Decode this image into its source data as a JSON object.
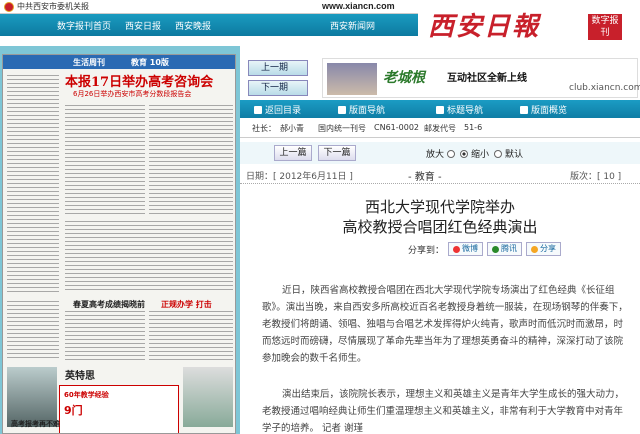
{
  "header": {
    "party_site": "中共西安市委机关报",
    "url": "www.xiancn.com",
    "nav": [
      "数字报刊首页",
      "西安日报",
      "西安晚报"
    ],
    "nav_right": "西安新闻网",
    "logo": "西安日報",
    "badge": "数字报刊"
  },
  "paper": {
    "section_1": "生活周刊",
    "section_2": "教育 10版",
    "headline": "本报17日举办高考咨询会",
    "subhead": "6月26日举办西安市高考分数段报告会",
    "box_1": "春夏高考成绩揭晓前",
    "box_2": "正规办学  打击",
    "brand": "英特思",
    "ad_title": "60年教学经验",
    "ad_big": "9门",
    "footer_box": "高考报考再不难"
  },
  "page_nav": {
    "prev": "上一期",
    "next": "下一期"
  },
  "banner": {
    "title": "老城根",
    "subtitle": "互动社区全新上线",
    "club": "club.xiancn.com"
  },
  "tabs": [
    "返回目录",
    "版面导航",
    "标题导航",
    "版面概览"
  ],
  "pub": {
    "president_label": "社长：",
    "president": "郝小青",
    "issn_label": "国内统一刊号",
    "issn": "CN61-0002",
    "postcode_label": "邮发代号",
    "postcode": "51-6"
  },
  "controls": {
    "prev_article": "上一篇",
    "next_article": "下一篇",
    "font_large": "放大",
    "font_small": "缩小",
    "font_default": "默认"
  },
  "info": {
    "date": "日期：[ 2012年6月11日 ]",
    "section": "-  教育  -",
    "page": "版次：[ 10 ]"
  },
  "article": {
    "title_line1": "西北大学现代学院举办",
    "title_line2": "高校教授合唱团红色经典演出",
    "share_label": "分享到：",
    "share_weibo": "微博",
    "share_qq": "腾讯",
    "share_kaixin": "分享",
    "para1": "近日，陕西省高校教授合唱团在西北大学现代学院专场演出了红色经典《长征组歌》。演出当晚，来自西安多所高校近百名老教授身着统一服装，在现场钢琴的伴奏下，老教授们将朗诵、领唱、独唱与合唱艺术发挥得炉火纯青，歌声时而低沉时而激昂，时而悠远时而磅礴，尽情展现了革命先辈当年为了理想英勇奋斗的精神，深深打动了该院参加晚会的数千名师生。",
    "para2": "演出结束后，该院院长表示，理想主义和英雄主义是青年大学生成长的强大动力，老教授通过唱响经典让师生们重温理想主义和英雄主义，非常有利于大学教育中对青年学子的培养。 记者 谢瑾"
  },
  "colors": {
    "nav_blue": "#0d7aa0",
    "logo_red": "#c8202b",
    "banner_green": "#2c7a2c"
  }
}
